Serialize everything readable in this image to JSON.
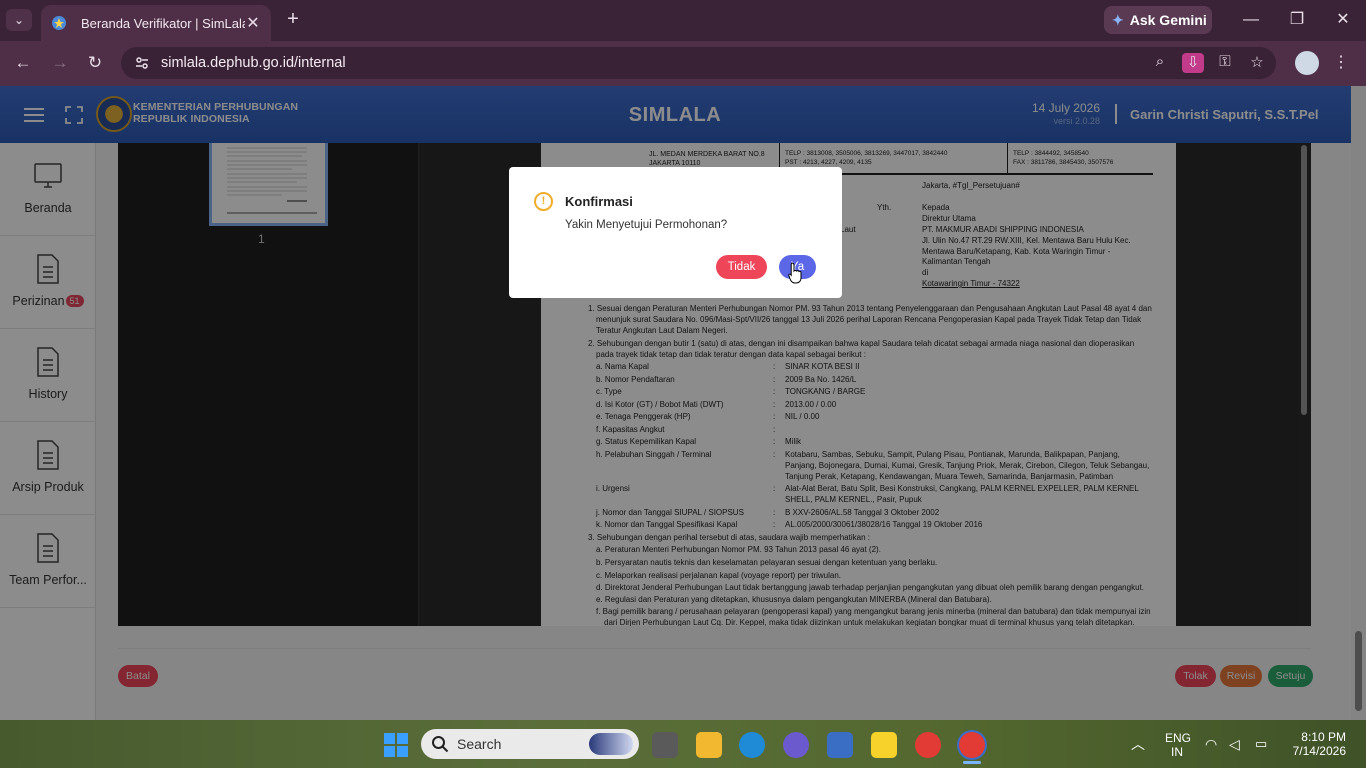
{
  "browser": {
    "tab_title": "Beranda Verifikator | SimLala",
    "url": "simlala.dephub.go.id/internal",
    "gemini_label": "Ask Gemini"
  },
  "header": {
    "ministry_line1": "KEMENTERIAN PERHUBUNGAN",
    "ministry_line2": "REPUBLIK INDONESIA",
    "brand": "SIMLALA",
    "date": "14 July 2026",
    "version": "versi 2.0.28",
    "user": "Garin Christi Saputri, S.S.T.Pel"
  },
  "sidebar": {
    "items": [
      {
        "label": "Beranda"
      },
      {
        "label": "Perizinan",
        "badge": "51"
      },
      {
        "label": "History"
      },
      {
        "label": "Arsip Produk"
      },
      {
        "label": "Team Perfor..."
      }
    ]
  },
  "viewer": {
    "page_number": "1"
  },
  "document": {
    "addr1": "JL. MEDAN MERDEKA BARAT NO.8",
    "addr2": "JAKARTA 10110",
    "telp_left": "TELP : 3813008, 3505006, 3813269, 3447017, 3842440",
    "pst_left": "PST : 4213, 4227, 4209, 4135",
    "telp_right": "TELP : 3844492, 3458540",
    "fax_right": "FAX : 3811786, 3845430, 3507576",
    "place_date": "Jakarta, #Tgl_Persetujuan#",
    "yth": "Yth.",
    "kepada": "Kepada",
    "dirut": "Direktur Utama",
    "company": "PT. MAKMUR ABADI SHIPPING INDONESIA",
    "addr_a": "Jl. Ulin No.47 RT.29 RW.XIII, Kel. Mentawa Baru Hulu Kec.",
    "addr_b": "Mentawa Baru/Ketapang, Kab. Kota Waringin Timur -",
    "addr_c": "Kalimantan Tengah",
    "di": "di",
    "city": "Kotawaringin Timur - 74322",
    "laut": "Laut",
    "p1a": "1. Sesuai dengan Peraturan Menteri Perhubungan Nomor PM. 93 Tahun 2013 tentang Penyelenggaraan dan Pengusahaan Angkutan Laut Pasal 48 ayat 4 dan",
    "p1b": "menunjuk surat Saudara No. 096/Masi-Spt/VII/26 tanggal 13 Juli 2026 perihal Laporan Rencana Pengoperasian Kapal pada Trayek Tidak Tetap dan Tidak",
    "p1c": "Teratur Angkutan Laut Dalam Negeri.",
    "p2a": "2. Sehubungan dengan butir 1 (satu) di atas, dengan ini disampaikan bahwa kapal Saudara telah dicatat sebagai armada niaga nasional dan dioperasikan",
    "p2b": "pada trayek tidak tetap dan tidak teratur dengan data kapal sebagai berikut :",
    "rows": [
      {
        "k": "a. Nama Kapal",
        "v": "SINAR KOTA BESI II"
      },
      {
        "k": "b. Nomor Pendaftaran",
        "v": "2009 Ba No. 1426/L"
      },
      {
        "k": "c. Type",
        "v": "TONGKANG / BARGE"
      },
      {
        "k": "d. Isi Kotor (GT) / Bobot Mati (DWT)",
        "v": "2013.00 / 0.00"
      },
      {
        "k": "e. Tenaga Penggerak (HP)",
        "v": "NIL / 0.00"
      },
      {
        "k": "f. Kapasitas Angkut",
        "v": ""
      },
      {
        "k": "g. Status Kepemilikan Kapal",
        "v": "Milik"
      }
    ],
    "h_key": "h. Pelabuhan Singgah / Terminal",
    "h_v1": "Kotabaru, Sambas, Sebuku, Sampit, Pulang Pisau, Pontianak, Marunda, Balikpapan, Panjang,",
    "h_v2": "Panjang, Bojonegara, Dumai, Kumai, Gresik, Tanjung Priok, Merak, Cirebon, Cilegon, Teluk Sebangau,",
    "h_v3": "Tanjung Perak, Ketapang, Kendawangan, Muara Teweh, Samarinda, Banjarmasin, Patimban",
    "i_key": "i. Urgensi",
    "i_v1": "Alat-Alat Berat, Batu Split, Besi Konstruksi, Cangkang, PALM KERNEL EXPELLER, PALM KERNEL",
    "i_v2": "SHELL, PALM KERNEL., Pasir, Pupuk",
    "j_key": "j. Nomor dan Tanggal SIUPAL / SIOPSUS",
    "j_v": "B XXV-2606/AL.58 Tanggal 3 Oktober 2002",
    "k_key": "k. Nomor dan Tanggal Spesifikasi Kapal",
    "k_v": "AL.005/2000/30061/38028/16 Tanggal 19 Oktober 2016",
    "p3": "3. Sehubungan dengan perihal tersebut di atas, saudara wajib memperhatikan :",
    "p3a": "a. Peraturan Menteri Perhubungan Nomor PM. 93 Tahun 2013 pasal 46 ayat (2).",
    "p3b": "b. Persyaratan nautis teknis dan keselamatan pelayaran sesuai dengan ketentuan yang berlaku.",
    "p3c": "c. Melaporkan realisasi perjalanan kapal (voyage report) per triwulan.",
    "p3d": "d. Direktorat Jenderal Perhubungan Laut tidak bertanggung jawab terhadap perjanjian pengangkutan yang dibuat oleh pemilik barang dengan pengangkut.",
    "p3e": "e. Regulasi dan Peraturan yang ditetapkan, khususnya dalam pengangkutan MINERBA (Mineral dan Batubara).",
    "p3f1": "f. Bagi pemilik barang / perusahaan pelayaran (pengoperasi kapal) yang mengangkut barang jenis minerba (mineral dan batubara) dan tidak mempunyai izin",
    "p3f2": "dari Dirjen Perhubungan Laut Cq. Dir. Keppel, maka tidak diizinkan untuk melakukan kegiatan bongkar muat di terminal khusus yang telah ditetapkan."
  },
  "actions": {
    "cancel": "Batal",
    "reject": "Tolak",
    "revise": "Revisi",
    "approve": "Setuju"
  },
  "modal": {
    "title": "Konfirmasi",
    "message": "Yakin Menyetujui Permohonan?",
    "no": "Tidak",
    "yes": "Ya"
  },
  "taskbar": {
    "search_placeholder": "Search",
    "lang1": "ENG",
    "lang2": "IN",
    "time": "8:10 PM",
    "date": "7/14/2026"
  },
  "colors": {
    "header_blue": "#3563c4",
    "danger": "#ee4559",
    "warning": "#e8793c",
    "success": "#2faa6a",
    "primary": "#5b67e6"
  }
}
